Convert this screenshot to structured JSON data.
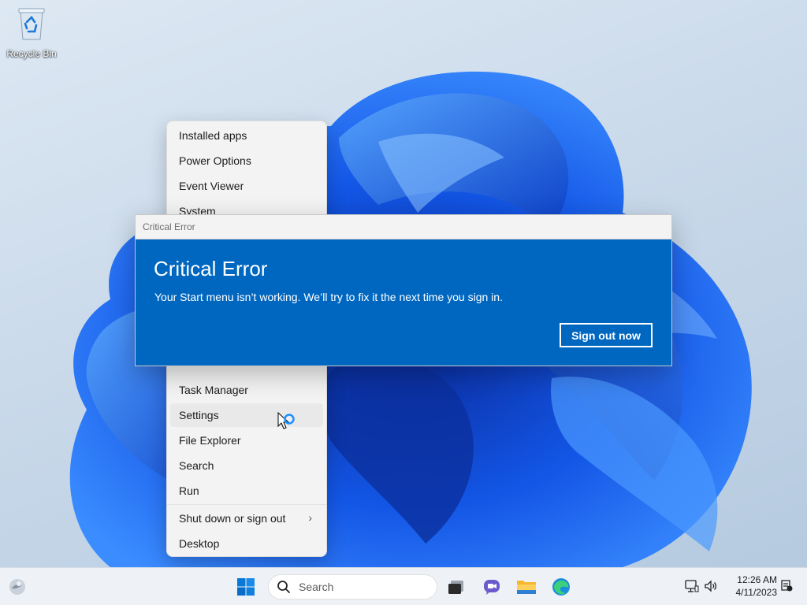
{
  "desktop": {
    "icons": [
      {
        "label": "Recycle Bin"
      }
    ]
  },
  "winx_menu": {
    "items": [
      {
        "label": "Installed apps"
      },
      {
        "label": "Power Options"
      },
      {
        "label": "Event Viewer"
      },
      {
        "label": "System"
      },
      {
        "label": "Task Manager"
      },
      {
        "label": "Settings"
      },
      {
        "label": "File Explorer"
      },
      {
        "label": "Search"
      },
      {
        "label": "Run"
      },
      {
        "label": "Shut down or sign out",
        "arrow": "›"
      },
      {
        "label": "Desktop"
      }
    ],
    "hovered_item": "Settings"
  },
  "dialog": {
    "window_title": "Critical Error",
    "heading": "Critical Error",
    "message": "Your Start menu isn’t working. We’ll try to fix it the next time you sign in.",
    "button_label": "Sign out now",
    "accent_color": "#0067c0"
  },
  "taskbar": {
    "search_placeholder": "Search",
    "pinned_icons": [
      "start-icon",
      "search-icon",
      "task-view-icon",
      "chat-icon",
      "file-explorer-icon",
      "edge-icon"
    ],
    "tray_icons": [
      "network-icon",
      "volume-icon",
      "notification-icon"
    ]
  },
  "clock": {
    "time": "12:26 AM",
    "date": "4/11/2023"
  }
}
